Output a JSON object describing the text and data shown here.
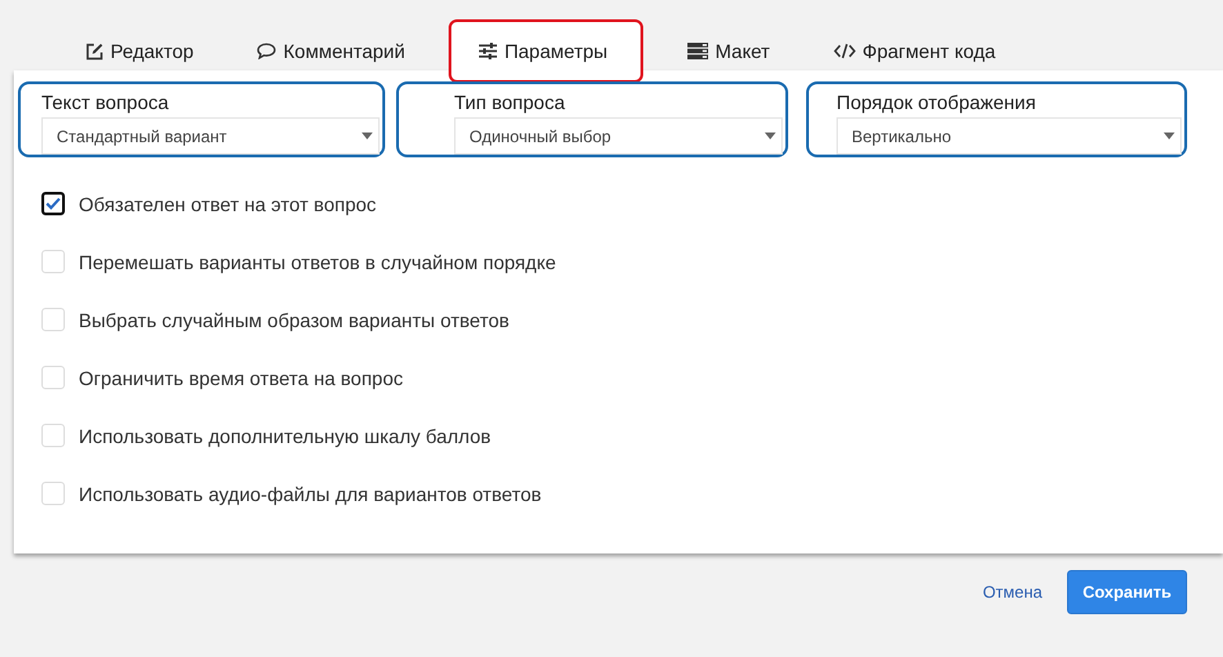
{
  "tabs": [
    {
      "label": "Редактор",
      "kind": "edit",
      "selected": false
    },
    {
      "label": "Комментарий",
      "kind": "comment",
      "selected": false
    },
    {
      "label": "Параметры",
      "kind": "sliders",
      "selected": true
    },
    {
      "label": "Макет",
      "kind": "layout",
      "selected": false
    },
    {
      "label": "Фрагмент кода",
      "kind": "code",
      "selected": false
    }
  ],
  "selects": [
    {
      "label": "Текст вопроса",
      "value": "Стандартный вариант"
    },
    {
      "label": "Тип вопроса",
      "value": "Одиночный выбор"
    },
    {
      "label": "Порядок отображения",
      "value": "Вертикально"
    }
  ],
  "options": [
    {
      "label": "Обязателен ответ на этот вопрос",
      "checked": true
    },
    {
      "label": "Перемешать варианты ответов в случайном порядке",
      "checked": false
    },
    {
      "label": "Выбрать случайным образом варианты ответов",
      "checked": false
    },
    {
      "label": "Ограничить время ответа на вопрос",
      "checked": false
    },
    {
      "label": "Использовать дополнительную шкалу баллов",
      "checked": false
    },
    {
      "label": "Использовать аудио-файлы для вариантов ответов",
      "checked": false
    }
  ],
  "footer": {
    "cancel": "Отмена",
    "save": "Сохранить"
  }
}
